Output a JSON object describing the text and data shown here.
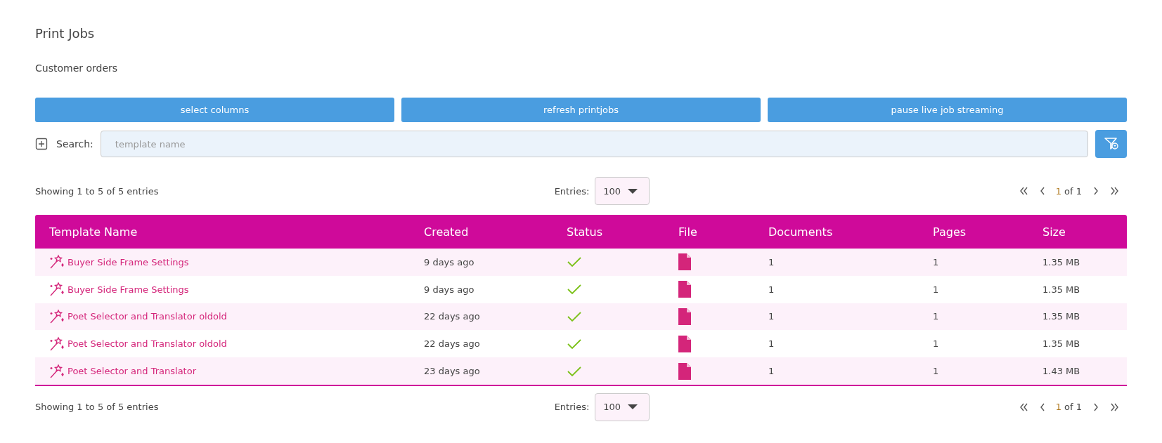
{
  "title": "Print Jobs",
  "subtitle": "Customer orders",
  "buttons": [
    "select columns",
    "refresh printjobs",
    "pause live job streaming"
  ],
  "search": {
    "label": "Search:",
    "placeholder": "template name"
  },
  "pagers": [
    {
      "summary": "Showing 1 to 5 of 5 entries",
      "entries_label": "Entries:",
      "entries_value": "100",
      "page": "1",
      "page_of": "of 1"
    },
    {
      "summary": "Showing 1 to 5 of 5 entries",
      "entries_label": "Entries:",
      "entries_value": "100",
      "page": "1",
      "page_of": "of 1"
    }
  ],
  "table": {
    "columns": [
      "Template Name",
      "Created",
      "Status",
      "File",
      "Documents",
      "Pages",
      "Size"
    ],
    "rows": [
      {
        "template": "Buyer Side Frame Settings",
        "created": "9 days ago",
        "succeeded": true,
        "documents": "1",
        "pages": "1",
        "size": "1.35 MB"
      },
      {
        "template": "Buyer Side Frame Settings",
        "created": "9 days ago",
        "succeeded": true,
        "documents": "1",
        "pages": "1",
        "size": "1.35 MB"
      },
      {
        "template": "Poet Selector and Translator oldold",
        "created": "22 days ago",
        "succeeded": true,
        "documents": "1",
        "pages": "1",
        "size": "1.35 MB"
      },
      {
        "template": "Poet Selector and Translator oldold",
        "created": "22 days ago",
        "succeeded": true,
        "documents": "1",
        "pages": "1",
        "size": "1.35 MB"
      },
      {
        "template": "Poet Selector and Translator",
        "created": "23 days ago",
        "succeeded": true,
        "documents": "1",
        "pages": "1",
        "size": "1.43 MB"
      }
    ]
  }
}
